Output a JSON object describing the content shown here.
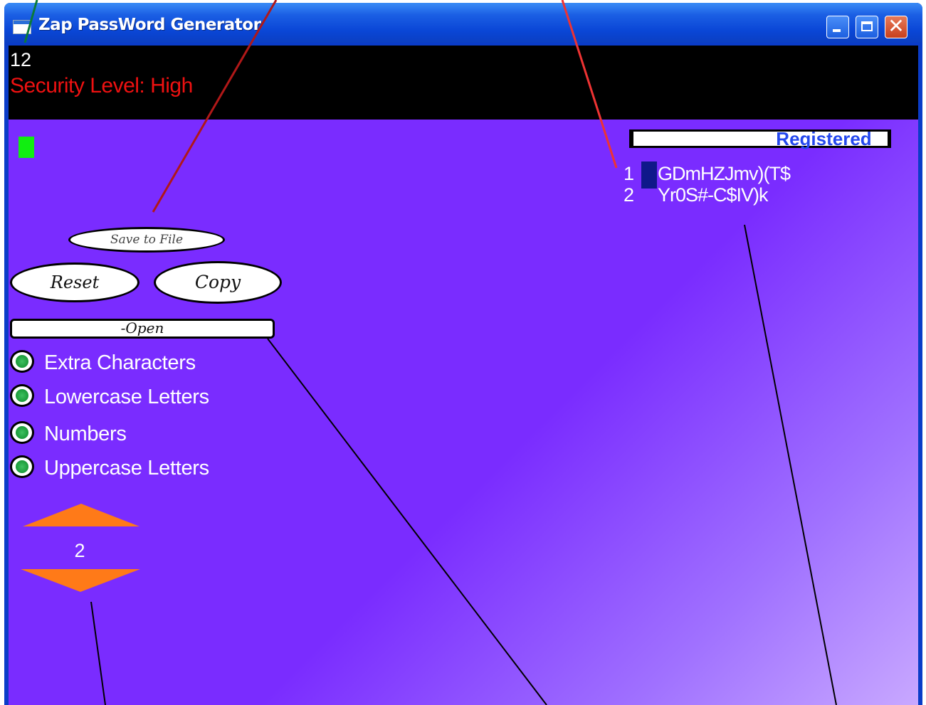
{
  "window": {
    "title": "Zap PassWord Generator",
    "controls": [
      "minimize",
      "maximize",
      "close"
    ],
    "close_glyph": "✕"
  },
  "header": {
    "length_value": "12",
    "security_label": "Security Level: High",
    "security_color": "#ee1111"
  },
  "status": {
    "registered_label": "Registered",
    "indicator_color": "#11ee11"
  },
  "passwords": [
    {
      "index": "1",
      "value": "GDmHZJmv)(T$"
    },
    {
      "index": "2",
      "value": "Yr0S#-C$IV)k"
    }
  ],
  "buttons": {
    "save": "Save to File",
    "reset": "Reset",
    "copy": "Copy",
    "open": "-Open"
  },
  "options": [
    {
      "label": "Extra Characters",
      "icon": "radio-on-icon"
    },
    {
      "label": "Lowercase Letters",
      "icon": "radio-on-icon"
    },
    {
      "label": "Numbers",
      "icon": "radio-on-icon"
    },
    {
      "label": "Uppercase Letters",
      "icon": "radio-on-icon"
    }
  ],
  "count": {
    "value": "2",
    "up_icon": "triangle-up-icon",
    "down_icon": "triangle-down-icon",
    "arrow_color": "#ff7a18"
  },
  "colors": {
    "background": "#7a2cff",
    "titlebar": "#0a46d6"
  }
}
